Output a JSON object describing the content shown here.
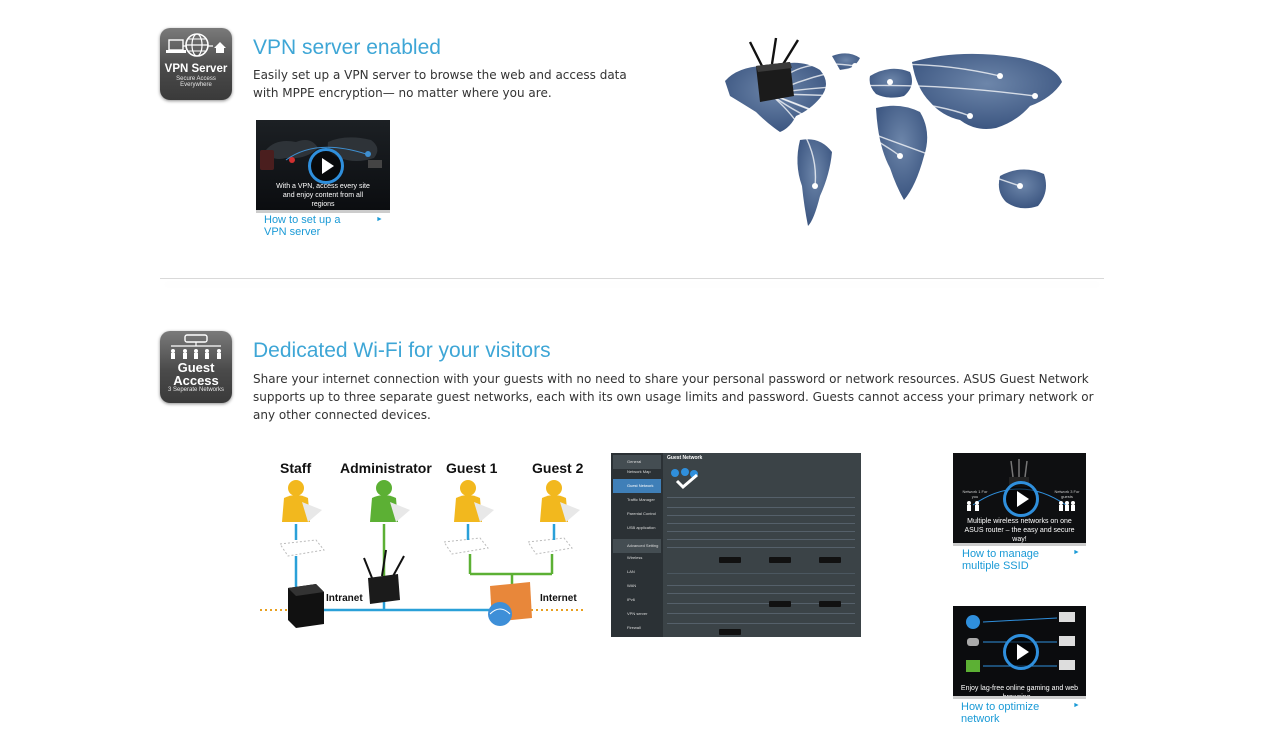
{
  "vpn": {
    "badge": {
      "title": "VPN Server",
      "subtitle": "Secure Access Everywhere"
    },
    "title": "VPN server enabled",
    "description": "Easily set up a VPN server to browse the web and access data with MPPE encryption— no matter where you are.",
    "video": {
      "caption": "With a VPN, access every site and enjoy content from all regions",
      "link": "How to set up a VPN server"
    }
  },
  "guest": {
    "badge": {
      "title_line1": "Guest",
      "title_line2": "Access",
      "subtitle": "3 Seperate Networks"
    },
    "title": "Dedicated Wi-Fi for your visitors",
    "description": "Share your internet connection with your guests with no need to share your personal password or network resources. ASUS Guest Network supports up to three separate guest networks, each with its own usage limits and password. Guests cannot access your primary network or any other connected devices.",
    "diagram": {
      "users": [
        "Staff",
        "Administrator",
        "Guest 1",
        "Guest 2"
      ],
      "intranet_label": "Intranet",
      "internet_label": "Internet"
    },
    "admin_panel": {
      "header": "Guest Network",
      "menu_general": "General",
      "menu_items": [
        "Network Map",
        "Guest Network",
        "Traffic Manager",
        "Parental Control",
        "USB application"
      ],
      "menu_advanced": "Advanced Setting",
      "advanced_items": [
        "Wireless",
        "LAN",
        "WAN",
        "IPv6",
        "VPN server",
        "Firewall"
      ]
    },
    "videos": [
      {
        "caption": "Multiple wireless networks on one ASUS router – the easy and secure way!",
        "link": "How to manage multiple SSID",
        "left_label": "Network 1 For you",
        "right_label": "Network 3 For guests"
      },
      {
        "caption": "Enjoy lag-free online gaming and web browsing...",
        "link": "How to optimize network"
      }
    ]
  },
  "colors": {
    "accent": "#3ea6d6",
    "link": "#1a9ad6",
    "map": "#4d6a94"
  }
}
